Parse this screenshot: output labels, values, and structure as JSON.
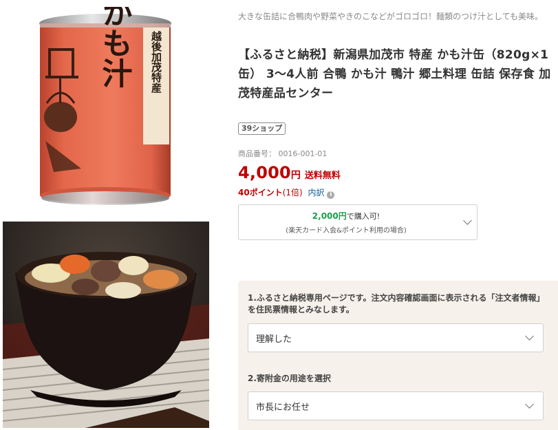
{
  "images": {
    "can_label_vertical_top": "越後",
    "can_label_vertical_bottom": "加茂特産",
    "can_title": "かも汁"
  },
  "product": {
    "subtitle": "大きな缶詰に合鴨肉や野菜やきのこなどがゴロゴロ！麺類のつけ汁としても美味。",
    "title": "【ふるさと納税】新潟県加茂市 特産 かも汁缶（820g×1缶） 3～4人前 合鴨 かも汁 鴨汁 郷土料理 缶詰 保存食 加茂特産品センター",
    "shop_badge": "39ショップ",
    "item_number": "商品番号： 0016-001-01",
    "price_number": "4,000",
    "price_yen": "円",
    "shipping": "送料無料",
    "points": "40ポイント",
    "points_multiplier": "(1倍)",
    "breakdown_label": "内訳",
    "info_icon_glyph": "i"
  },
  "card_offer": {
    "amount": "2,000円",
    "suffix": "で購入可!",
    "condition": "(楽天カード入会&ポイント利用の場合)"
  },
  "form": {
    "q1_label": "1.ふるさと納税専用ページです。注文内容確認画面に表示される「注文者情報」を住民票情報とみなします。",
    "q1_value": "理解した",
    "q2_label": "2.寄附金の用途を選択",
    "q2_value": "市長にお任せ"
  },
  "colors": {
    "price_red": "#bf0000",
    "green": "#1b9e4a",
    "form_bg": "#f6f1ea",
    "can_orange": "#e4674a",
    "link_blue": "#0f5d9a"
  }
}
